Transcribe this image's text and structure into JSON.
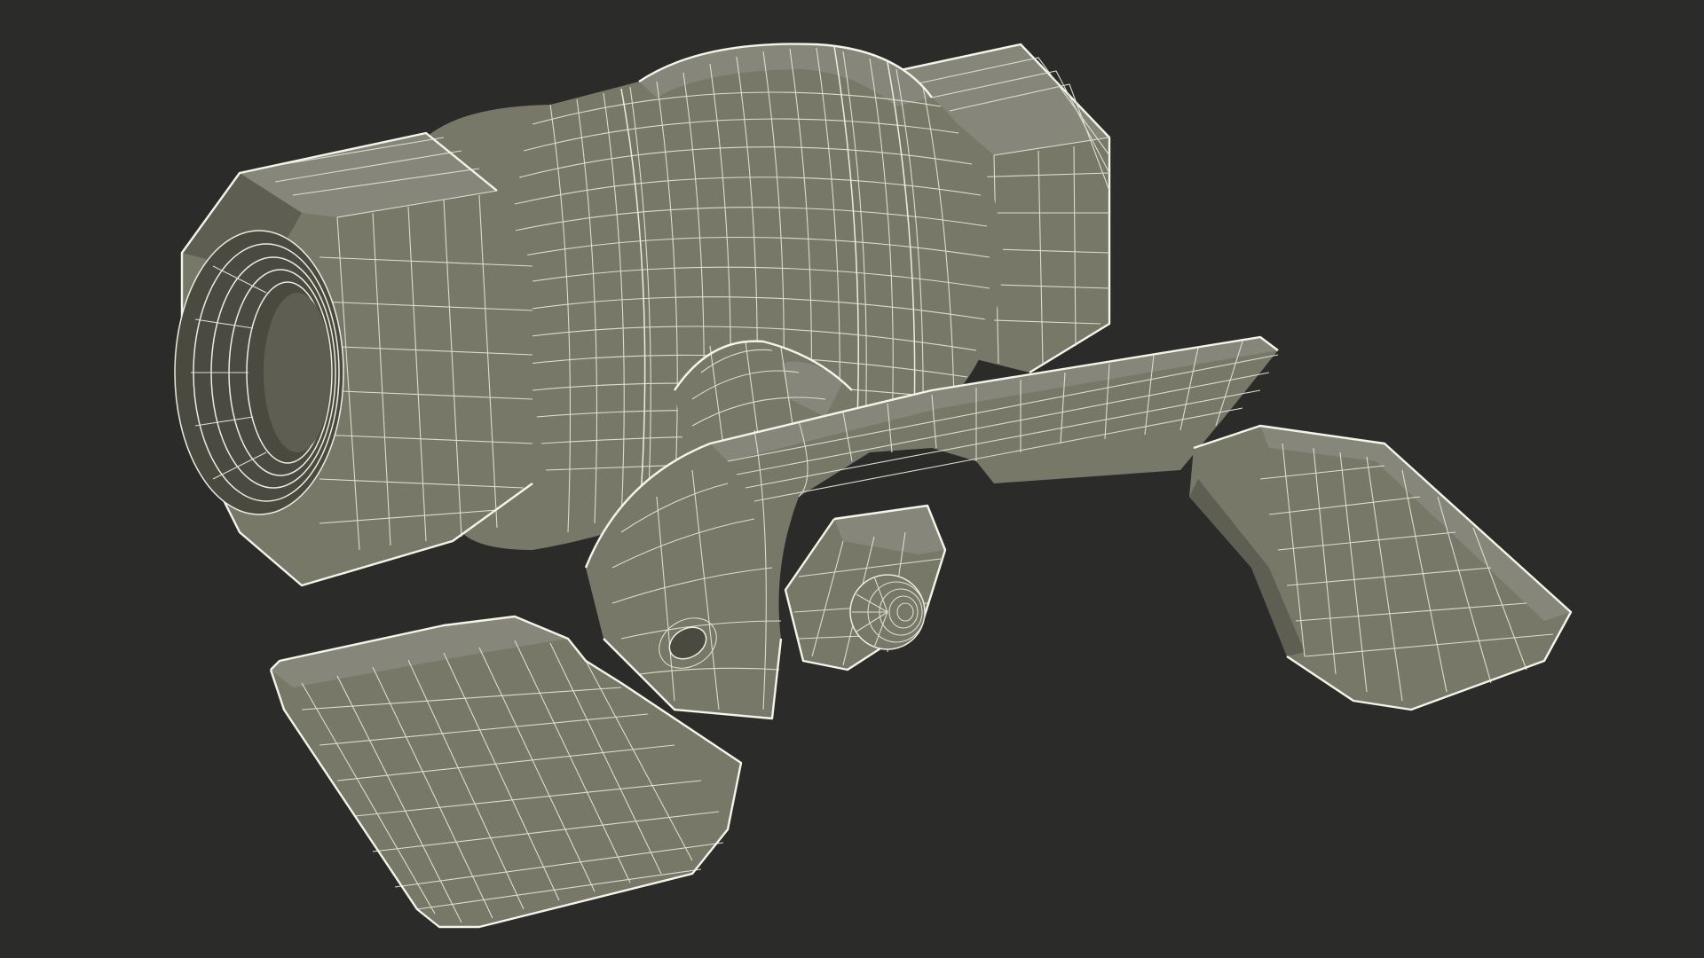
{
  "scene": {
    "background_color": "#2b2b2a",
    "model_fill_color": "#787869",
    "wireframe_color": "#ececdf",
    "parts": [
      "threaded-pipe-end",
      "hex-nut-body",
      "valve-body-cylinder",
      "rear-hex-end",
      "stem-bracket",
      "lever-handle",
      "handle-grip-left",
      "handle-grip-right",
      "stem-nut",
      "stem-cap"
    ]
  }
}
